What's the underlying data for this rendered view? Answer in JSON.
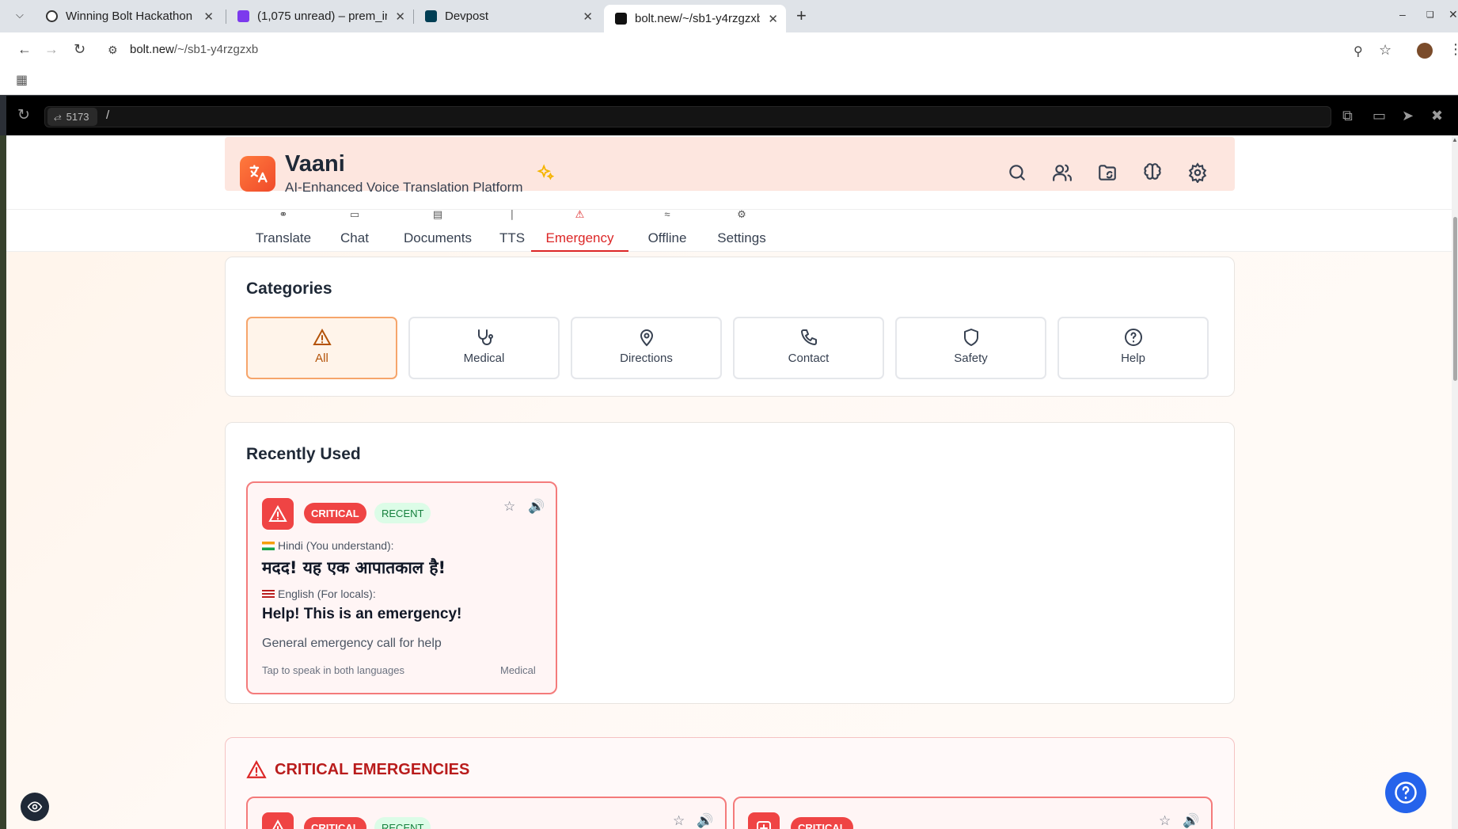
{
  "browser": {
    "tabs": [
      {
        "title": "Winning Bolt Hackathon"
      },
      {
        "title": "(1,075 unread) – prem_ir"
      },
      {
        "title": "Devpost"
      },
      {
        "title": "bolt.new/~/sb1-y4rzgzxb"
      }
    ],
    "new_tab": "+",
    "url": "bolt.new/~/sb1-y4rzgzxb",
    "url_host": "bolt.new",
    "url_path": "/~/sb1-y4rzgzxb"
  },
  "preview": {
    "port": "5173",
    "path": "/"
  },
  "app": {
    "name": "Vaani",
    "tagline": "AI-Enhanced Voice Translation Platform",
    "nav": [
      {
        "label": "Translate"
      },
      {
        "label": "Chat"
      },
      {
        "label": "Documents"
      },
      {
        "label": "TTS"
      },
      {
        "label": "Emergency"
      },
      {
        "label": "Offline"
      },
      {
        "label": "Settings"
      }
    ],
    "active_nav": "Emergency"
  },
  "categories": {
    "title": "Categories",
    "items": [
      {
        "label": "All"
      },
      {
        "label": "Medical"
      },
      {
        "label": "Directions"
      },
      {
        "label": "Contact"
      },
      {
        "label": "Safety"
      },
      {
        "label": "Help"
      }
    ],
    "active": "All"
  },
  "recently_used": {
    "title": "Recently Used",
    "card": {
      "badge_critical": "CRITICAL",
      "badge_recent": "RECENT",
      "source_label": "Hindi (You understand):",
      "source_text": "मदद! यह एक आपातकाल है!",
      "target_label": "English (For locals):",
      "target_text": "Help! This is an emergency!",
      "description": "General emergency call for help",
      "footer_hint": "Tap to speak in both languages",
      "category": "Medical"
    }
  },
  "critical": {
    "title": "CRITICAL EMERGENCIES",
    "cards": [
      {
        "badge_critical": "CRITICAL",
        "badge_recent": "RECENT"
      },
      {
        "badge_critical": "CRITICAL"
      }
    ]
  },
  "colors": {
    "accent": "#dc2626",
    "brand": "#f05a2a",
    "critical": "#ef4444",
    "recent": "#15803d"
  }
}
